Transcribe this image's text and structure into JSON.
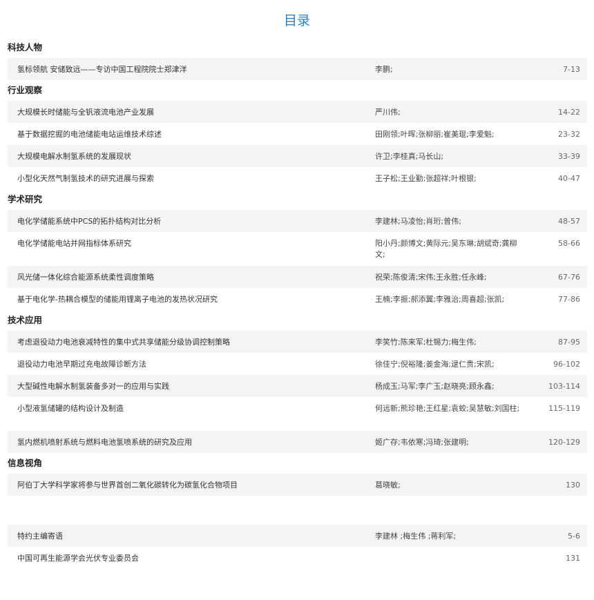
{
  "title": "目录",
  "sections": [
    {
      "name": "科技人物",
      "items": [
        {
          "title": "氢标领航 安储致远——专访中国工程院院士郑津洋",
          "authors": "李鹏;",
          "pages": "7-13"
        }
      ]
    },
    {
      "name": "行业观察",
      "items": [
        {
          "title": "大规模长时储能与全钒液流电池产业发展",
          "authors": "严川伟;",
          "pages": "14-22"
        },
        {
          "title": "基于数据挖掘的电池储能电站运维技术综述",
          "authors": "田刚领;叶晖;张柳丽;崔美琨;李爱魁;",
          "pages": "23-32"
        },
        {
          "title": "大规模电解水制氢系统的发展现状",
          "authors": "许卫;李桂真;马长山;",
          "pages": "33-39"
        },
        {
          "title": "小型化天然气制氢技术的研究进展与探索",
          "authors": "王子松;王业勤;张超祥;叶根银;",
          "pages": "40-47"
        }
      ]
    },
    {
      "name": "学术研究",
      "items": [
        {
          "title": "电化学储能系统中PCS的拓扑结构对比分析",
          "authors": "李建林;马凌怡;肖珩;曾伟;",
          "pages": "48-57"
        },
        {
          "title": "电化学储能电站并网指标体系研究",
          "authors": "阳小丹;颜博文;黄际元;吴东琳;胡斌奇;龚柳文;",
          "pages": "58-66"
        },
        {
          "title": "风光储一体化综合能源系统柔性调度策略",
          "authors": "祝荣;陈俊清;宋伟;王永胜;任永峰;",
          "pages": "67-76"
        },
        {
          "title": "基于电化学-热耦合模型的储能用锂离子电池的发热状况研究",
          "authors": "王楠;李振;郝添翼;李雅治;周喜超;张凯;",
          "pages": "77-86"
        }
      ]
    },
    {
      "name": "技术应用",
      "items": [
        {
          "title": "考虑退役动力电池衰减特性的集中式共享储能分级协调控制策略",
          "authors": "李笑竹;陈来军;杜锡力;梅生伟;",
          "pages": "87-95"
        },
        {
          "title": "退役动力电池早期过充电故障诊断方法",
          "authors": "徐佳宁;倪裕隆;姜金海;逯仁贵;宋凯;",
          "pages": "96-102"
        },
        {
          "title": "大型碱性电解水制氢装备多对一的应用与实践",
          "authors": "杨成玉;马军;李广玉;赵晓亮;顾永鑫;",
          "pages": "103-114"
        },
        {
          "title": "小型液氢储罐的结构设计及制造",
          "authors": "何远新;熊珍艳;王红星;袁蛟;吴慧敏;刘国柱;",
          "pages": "115-119"
        },
        {
          "title": "氢内燃机喷射系统与燃料电池氢喷系统的研究及应用",
          "authors": "姬广存;韦依寒;冯琦;张建明;",
          "pages": "120-129"
        }
      ]
    },
    {
      "name": "信息视角",
      "items": [
        {
          "title": "阿伯丁大学科学家将参与世界首创二氧化碳转化为碳氢化合物项目",
          "authors": "葛晓敏;",
          "pages": "130"
        }
      ]
    }
  ],
  "extra": [
    {
      "title": "特约主编寄语",
      "authors": "李建林 ;梅生伟 ;蒋利军;",
      "pages": "5-6"
    },
    {
      "title": "中国可再生能源学会光伏专业委员会",
      "authors": "",
      "pages": "131"
    }
  ],
  "colors": {
    "title": "#2a7fc4",
    "row_shade": "#f4f4f4"
  }
}
